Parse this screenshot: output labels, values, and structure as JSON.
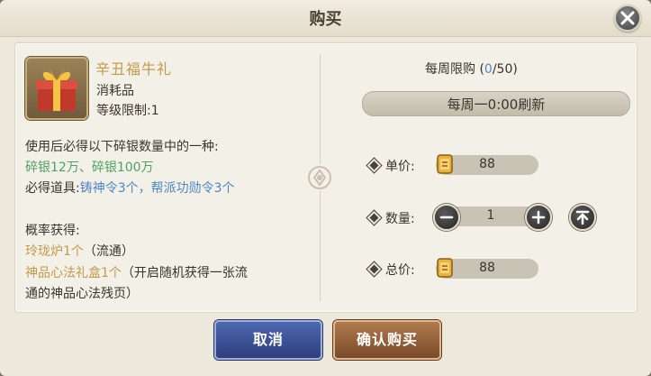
{
  "dialog": {
    "title": "购买"
  },
  "item": {
    "name": "辛丑福牛礼",
    "category": "消耗品",
    "level_limit": "等级限制:1"
  },
  "description": {
    "line1": "使用后必得以下碎银数量中的一种:",
    "silver_options": "碎银12万、碎银100万",
    "required_label": "必得道具:",
    "required_items": "铸神令3个，帮派功勋令3个",
    "chance_label": "概率获得:",
    "chance_item1": "玲珑炉1个",
    "chance_item1_note": "（流通）",
    "chance_item2": "神品心法礼盒1个",
    "chance_item2_note": "（开启随机获得一张流",
    "chance_item2_note2": "通的神品心法残页）"
  },
  "purchase": {
    "weekly_limit_label": "每周限购 (",
    "weekly_bought": "0",
    "weekly_limit_total": "/50)",
    "refresh_text": "每周一0:00刷新",
    "unit_price_label": "单价:",
    "unit_price": "88",
    "quantity_label": "数量:",
    "quantity": "1",
    "total_label": "总价:",
    "total_price": "88"
  },
  "buttons": {
    "cancel": "取消",
    "confirm": "确认购买"
  },
  "icons": {
    "close": "close-icon",
    "gift": "gift-box-icon",
    "ticket": "scroll-ticket-icon",
    "minus": "minus-icon",
    "plus": "plus-icon",
    "max": "max-arrow-icon"
  }
}
